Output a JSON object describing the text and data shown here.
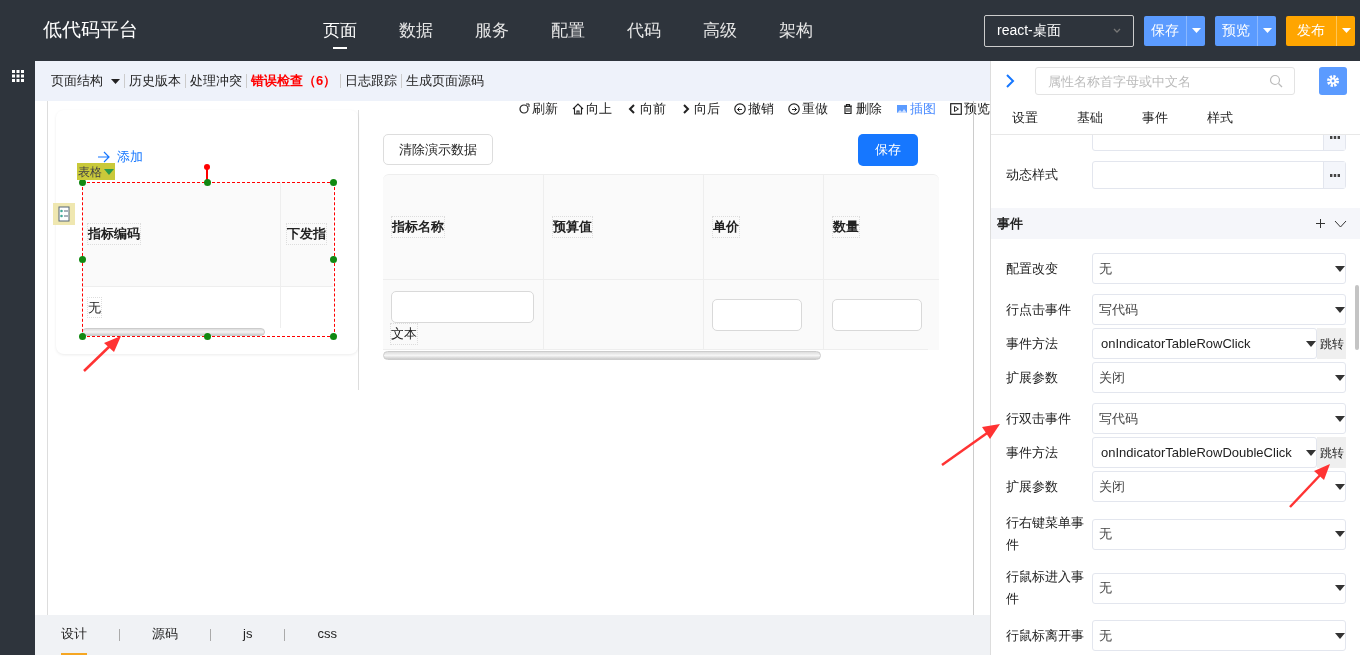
{
  "app": {
    "title": "低代码平台"
  },
  "nav": [
    {
      "label": "页面",
      "selected": true
    },
    {
      "label": "数据",
      "selected": false
    },
    {
      "label": "服务",
      "selected": false
    },
    {
      "label": "配置",
      "selected": false
    },
    {
      "label": "代码",
      "selected": false
    },
    {
      "label": "高级",
      "selected": false
    },
    {
      "label": "架构",
      "selected": false
    }
  ],
  "env_select": {
    "value": "react-桌面"
  },
  "header_buttons": [
    {
      "label": "保存",
      "kind": "primary"
    },
    {
      "label": "预览",
      "kind": "primary"
    },
    {
      "label": "发布",
      "kind": "warning"
    }
  ],
  "toolbar": [
    {
      "label": "页面结构",
      "kind": "dropdown"
    },
    {
      "label": "历史版本",
      "kind": "plain"
    },
    {
      "label": "处理冲突",
      "kind": "plain"
    },
    {
      "label": "错误检查（6）",
      "kind": "error"
    },
    {
      "label": "日志跟踪",
      "kind": "plain"
    },
    {
      "label": "生成页面源码",
      "kind": "plain"
    }
  ],
  "canvas_actions": [
    {
      "label": "刷新",
      "active": false
    },
    {
      "label": "向上",
      "active": false
    },
    {
      "label": "向前",
      "active": false
    },
    {
      "label": "向后",
      "active": false
    },
    {
      "label": "撤销",
      "active": false
    },
    {
      "label": "重做",
      "active": false
    },
    {
      "label": "删除",
      "active": false
    },
    {
      "label": "插图",
      "active": true
    },
    {
      "label": "预览",
      "active": false
    }
  ],
  "left_card": {
    "add_link": "添加",
    "component_tag": "表格",
    "columns": [
      "指标编码",
      "下发指"
    ],
    "rows": [
      [
        "无",
        ""
      ]
    ]
  },
  "right_area": {
    "clear_button": "清除演示数据",
    "save_button": "保存",
    "columns": [
      "指标名称",
      "预算值",
      "单价",
      "数量"
    ],
    "cells": [
      {
        "kind": "input_caption",
        "caption": "文本"
      },
      {
        "kind": "empty"
      },
      {
        "kind": "input"
      },
      {
        "kind": "input"
      }
    ]
  },
  "bottom_tabs": [
    {
      "label": "设计",
      "selected": true
    },
    {
      "label": "源码",
      "selected": false
    },
    {
      "label": "js",
      "selected": false
    },
    {
      "label": "css",
      "selected": false
    }
  ],
  "props": {
    "search": {
      "placeholder": "属性名称首字母或中文名"
    },
    "tabs": [
      "设置",
      "基础",
      "事件",
      "样式"
    ],
    "style_fields": [
      {
        "kind": "unlabeled"
      },
      {
        "kind": "labeled",
        "label": "动态样式"
      }
    ],
    "section": {
      "title": "事件"
    },
    "event_groups": [
      [
        {
          "label": "配置改变",
          "value": "无",
          "kind": "select"
        }
      ],
      [
        {
          "label": "行点击事件",
          "value": "写代码",
          "kind": "select"
        },
        {
          "label": "事件方法",
          "value": "onIndicatorTableRowClick",
          "kind": "method",
          "jump": "跳转"
        },
        {
          "label": "扩展参数",
          "value": "关闭",
          "kind": "select"
        }
      ],
      [
        {
          "label": "行双击事件",
          "value": "写代码",
          "kind": "select"
        },
        {
          "label": "事件方法",
          "value": "onIndicatorTableRowDoubleClick",
          "kind": "method",
          "jump": "跳转"
        },
        {
          "label": "扩展参数",
          "value": "关闭",
          "kind": "select"
        }
      ],
      [
        {
          "label": "行右键菜单事件",
          "value": "无",
          "kind": "select"
        }
      ],
      [
        {
          "label": "行鼠标进入事件",
          "value": "无",
          "kind": "select"
        }
      ],
      [
        {
          "label": "行鼠标离开事",
          "value": "无",
          "kind": "select"
        }
      ]
    ]
  }
}
